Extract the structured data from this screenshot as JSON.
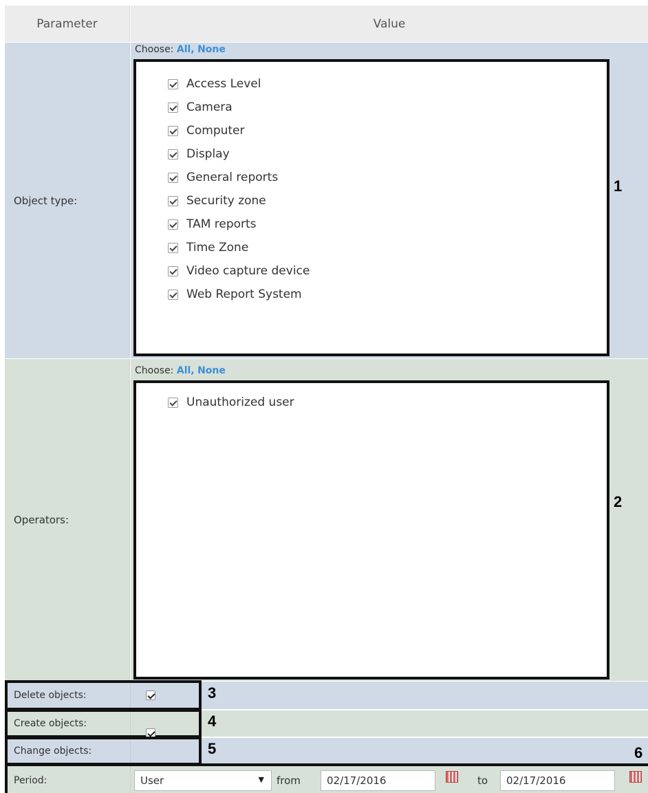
{
  "header": {
    "param_label": "Parameter",
    "value_label": "Value"
  },
  "choose": {
    "prefix": "Choose:",
    "all": "All",
    "sep": ",",
    "none": "None"
  },
  "object_type": {
    "label": "Object type:",
    "items": [
      "Access Level",
      "Camera",
      "Computer",
      "Display",
      "General reports",
      "Security zone",
      "TAM reports",
      "Time Zone",
      "Video capture device",
      "Web Report System"
    ],
    "callout": "1"
  },
  "operators": {
    "label": "Operators:",
    "items": [
      "Unauthorized user"
    ],
    "callout": "2"
  },
  "delete_objects": {
    "label": "Delete objects:",
    "callout": "3"
  },
  "create_objects": {
    "label": "Create objects:",
    "callout": "4"
  },
  "change_objects": {
    "label": "Change objects:",
    "callout": "5"
  },
  "period": {
    "label": "Period:",
    "select_value": "User",
    "from_label": "from",
    "from_date": "02/17/2016",
    "to_label": "to",
    "to_date": "02/17/2016",
    "callout": "6"
  },
  "icons": {
    "calendar": "calendar-icon",
    "dropdown": "triangle-down-icon",
    "checkbox": "checkbox-checked-icon"
  }
}
